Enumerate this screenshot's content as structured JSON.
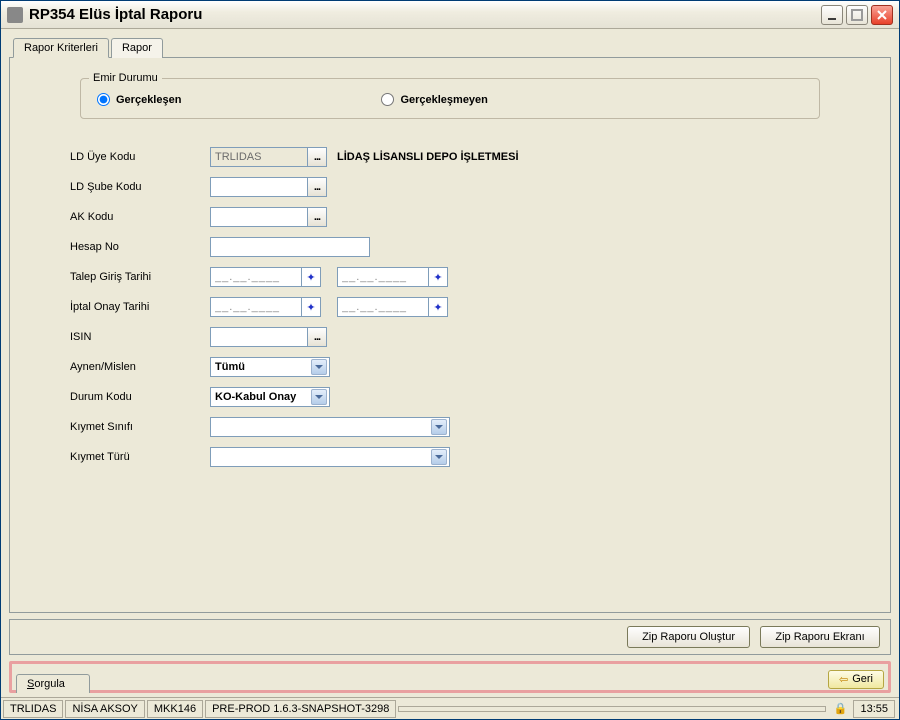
{
  "window": {
    "title": "RP354 Elüs İptal Raporu"
  },
  "tabs": {
    "criteria": "Rapor Kriterleri",
    "report": "Rapor"
  },
  "emir_durumu": {
    "legend": "Emir Durumu",
    "gerceklesen": "Gerçekleşen",
    "gerceklesmeyen": "Gerçekleşmeyen"
  },
  "labels": {
    "ld_uye_kodu": "LD Üye Kodu",
    "ld_sube_kodu": "LD Şube Kodu",
    "ak_kodu": "AK Kodu",
    "hesap_no": "Hesap No",
    "talep_giris": "Talep Giriş Tarihi",
    "iptal_onay": "İptal Onay Tarihi",
    "isin": "ISIN",
    "aynen_mislen": "Aynen/Mislen",
    "durum_kodu": "Durum Kodu",
    "kiymet_sinifi": "Kıymet Sınıfı",
    "kiymet_turu": "Kıymet Türü"
  },
  "values": {
    "ld_uye_kodu": "TRLIDAS",
    "ld_uye_kodu_desc": "LİDAŞ LİSANSLI DEPO İŞLETMESİ",
    "ld_sube_kodu": "",
    "ak_kodu": "",
    "hesap_no": "",
    "talep_giris_from": "__.__.____",
    "talep_giris_to": "__.__.____",
    "iptal_onay_from": "__.__.____",
    "iptal_onay_to": "__.__.____",
    "isin": "",
    "aynen_mislen": "Tümü",
    "durum_kodu": "KO-Kabul Onay",
    "kiymet_sinifi": "",
    "kiymet_turu": ""
  },
  "browse_label": "...",
  "actions": {
    "zip_olustur": "Zip Raporu Oluştur",
    "zip_ekrani": "Zip Raporu Ekranı"
  },
  "footer": {
    "sorgula": "Sorgula",
    "geri": "Geri"
  },
  "status": {
    "uye": "TRLIDAS",
    "user": "NİSA AKSOY",
    "code": "MKK146",
    "env": "PRE-PROD 1.6.3-SNAPSHOT-3298",
    "time": "13:55"
  }
}
